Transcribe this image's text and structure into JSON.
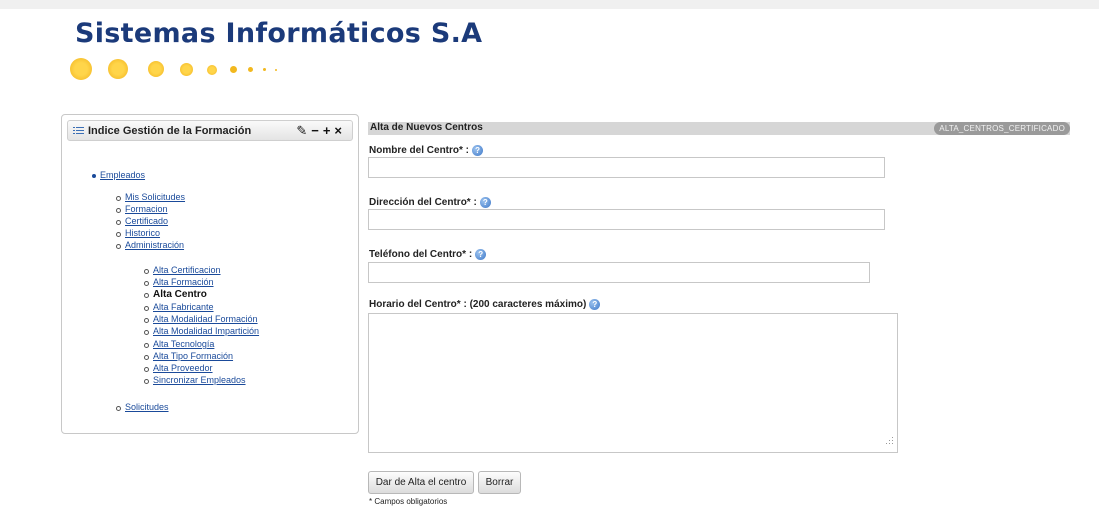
{
  "header": {
    "logo_title": "Sistemas Informáticos S.A"
  },
  "sidebar": {
    "title": "Indice Gestión de la Formación",
    "tools": [
      "wrench",
      "minus",
      "plus",
      "close"
    ],
    "tool_glyphs": [
      "✎",
      "−",
      "+",
      "×"
    ],
    "top_item": "Empleados",
    "sub_items": [
      "Mis Solicitudes",
      "Formacion",
      "Certificado",
      "Historico",
      "Administración"
    ],
    "admin_items": [
      "Alta Certificacion",
      "Alta Formación",
      "Alta Centro",
      "Alta Fabricante",
      "Alta Modalidad Formación",
      "Alta Modalidad Impartición",
      "Alta Tecnología",
      "Alta Tipo Formación",
      "Alta Proveedor",
      "Sincronizar Empleados"
    ],
    "current_item": "Alta Centro",
    "last_item": "Solicitudes"
  },
  "form": {
    "title": "Alta de Nuevos Centros",
    "code": "ALTA_CENTROS_CERTIFICADO",
    "fields": {
      "nombre_label": "Nombre del Centro* :",
      "nombre_value": "",
      "direccion_label": "Dirección del Centro* :",
      "direccion_value": "",
      "telefono_label": "Teléfono del Centro* :",
      "telefono_value": "",
      "horario_label": "Horario del Centro* : (200 caracteres máximo)",
      "horario_value": ""
    },
    "submit_label": "Dar de Alta el centro",
    "reset_label": "Borrar",
    "required_note": "* Campos obligatorios"
  },
  "colors": {
    "logo_blue": "#1b3a7a",
    "dots_gold": "#f2b81e",
    "link_blue": "#1a4a9a"
  }
}
